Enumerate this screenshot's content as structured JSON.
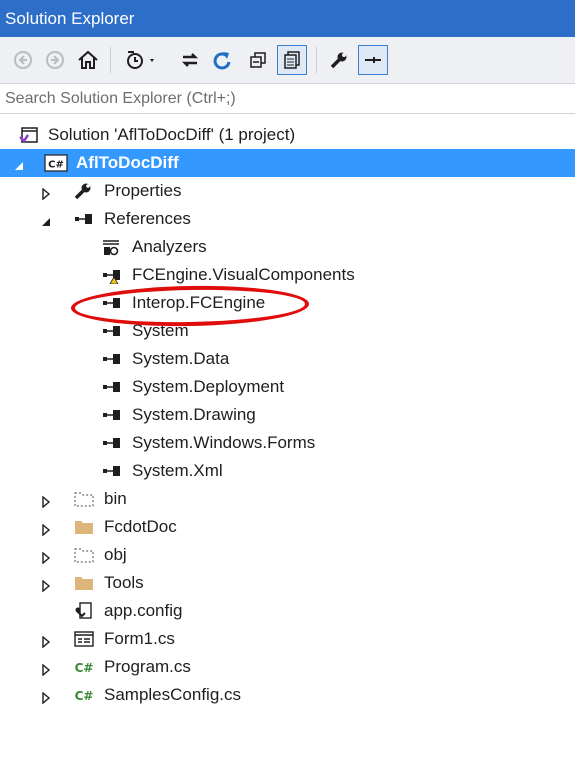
{
  "window": {
    "title": "Solution Explorer"
  },
  "toolbar": {
    "buttons": [
      {
        "name": "back-icon"
      },
      {
        "name": "forward-icon"
      },
      {
        "name": "home-icon"
      },
      {
        "name": "pending-changes-filter-icon"
      },
      {
        "name": "sync-with-active-document-icon"
      },
      {
        "name": "refresh-icon"
      },
      {
        "name": "collapse-all-icon"
      },
      {
        "name": "show-all-files-icon"
      },
      {
        "name": "properties-icon"
      },
      {
        "name": "preview-selected-items-icon"
      }
    ]
  },
  "search": {
    "placeholder": "Search Solution Explorer (Ctrl+;)"
  },
  "tree": {
    "solution": "Solution 'AflToDocDiff' (1 project)",
    "project": "AflToDocDiff",
    "properties": "Properties",
    "references": "References",
    "refs": [
      "Analyzers",
      "FCEngine.VisualComponents",
      "Interop.FCEngine",
      "System",
      "System.Data",
      "System.Deployment",
      "System.Drawing",
      "System.Windows.Forms",
      "System.Xml"
    ],
    "folders": [
      "bin",
      "FcdotDoc",
      "obj",
      "Tools"
    ],
    "files": [
      "app.config",
      "Form1.cs",
      "Program.cs",
      "SamplesConfig.cs"
    ]
  },
  "colors": {
    "title_bg": "#2d6ec9",
    "selection_bg": "#3399ff",
    "annotation": "#e00d0d",
    "folder": "#dcb67a",
    "csharp": "#388a34"
  }
}
